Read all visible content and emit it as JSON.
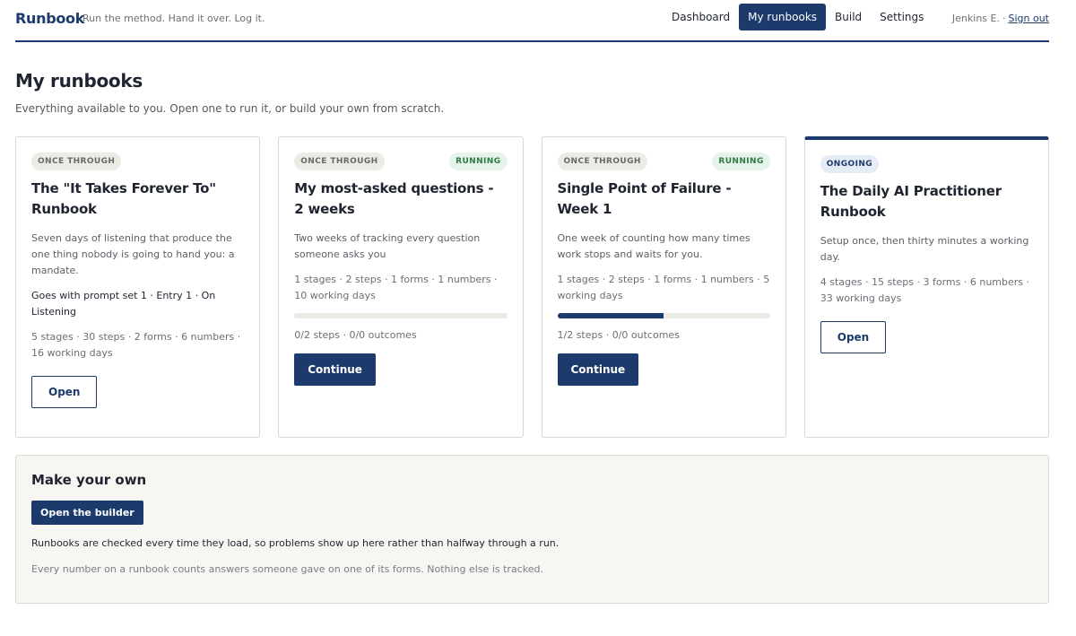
{
  "header": {
    "brand": "Runbook",
    "tagline": "Run the method. Hand it over. Log it.",
    "nav": [
      {
        "label": "Dashboard",
        "active": false
      },
      {
        "label": "My runbooks",
        "active": true
      },
      {
        "label": "Build",
        "active": false
      },
      {
        "label": "Settings",
        "active": false
      }
    ],
    "user_name": "Jenkins E.",
    "separator": "·",
    "sign_out": "Sign out"
  },
  "page": {
    "title": "My runbooks",
    "subtitle": "Everything available to you. Open one to run it, or build your own from scratch."
  },
  "cards": [
    {
      "type_badge": "ONCE THROUGH",
      "status_badge": "",
      "title": "The \"It Takes Forever To\" Runbook",
      "description": "Seven days of listening that produce the one thing nobody is going to hand you: a mandate.",
      "extra": "Goes with prompt set 1 · Entry 1 · On Listening",
      "meta": "5 stages · 30 steps · 2 forms · 6 numbers · 16 working days",
      "action": "Open"
    },
    {
      "type_badge": "ONCE THROUGH",
      "status_badge": "RUNNING",
      "title": "My most-asked questions - 2 weeks",
      "description": "Two weeks of tracking every question someone asks you",
      "meta": "1 stages · 2 steps · 1 forms · 1 numbers · 10 working days",
      "progress_fraction": 0,
      "progress_text": "0/2 steps · 0/0 outcomes",
      "action": "Continue"
    },
    {
      "type_badge": "ONCE THROUGH",
      "status_badge": "RUNNING",
      "title": "Single Point of Failure - Week 1",
      "description": "One week of counting how many times work stops and waits for you.",
      "meta": "1 stages · 2 steps · 1 forms · 1 numbers · 5 working days",
      "progress_fraction": 0.5,
      "progress_text": "1/2 steps · 0/0 outcomes",
      "action": "Continue"
    },
    {
      "type_badge": "ONGOING",
      "title": "The Daily AI Practitioner Runbook",
      "description": "Setup once, then thirty minutes a working day.",
      "meta": "4 stages · 15 steps · 3 forms · 6 numbers · 33 working days",
      "action": "Open"
    }
  ],
  "make_own": {
    "title": "Make your own",
    "button": "Open the builder",
    "text": "Runbooks are checked every time they load, so problems show up here rather than halfway through a run.",
    "note": "Every number on a runbook counts answers someone gave on one of its forms. Nothing else is tracked."
  },
  "colors": {
    "accent": "#1c3a6b",
    "running": "#2f7a45"
  }
}
